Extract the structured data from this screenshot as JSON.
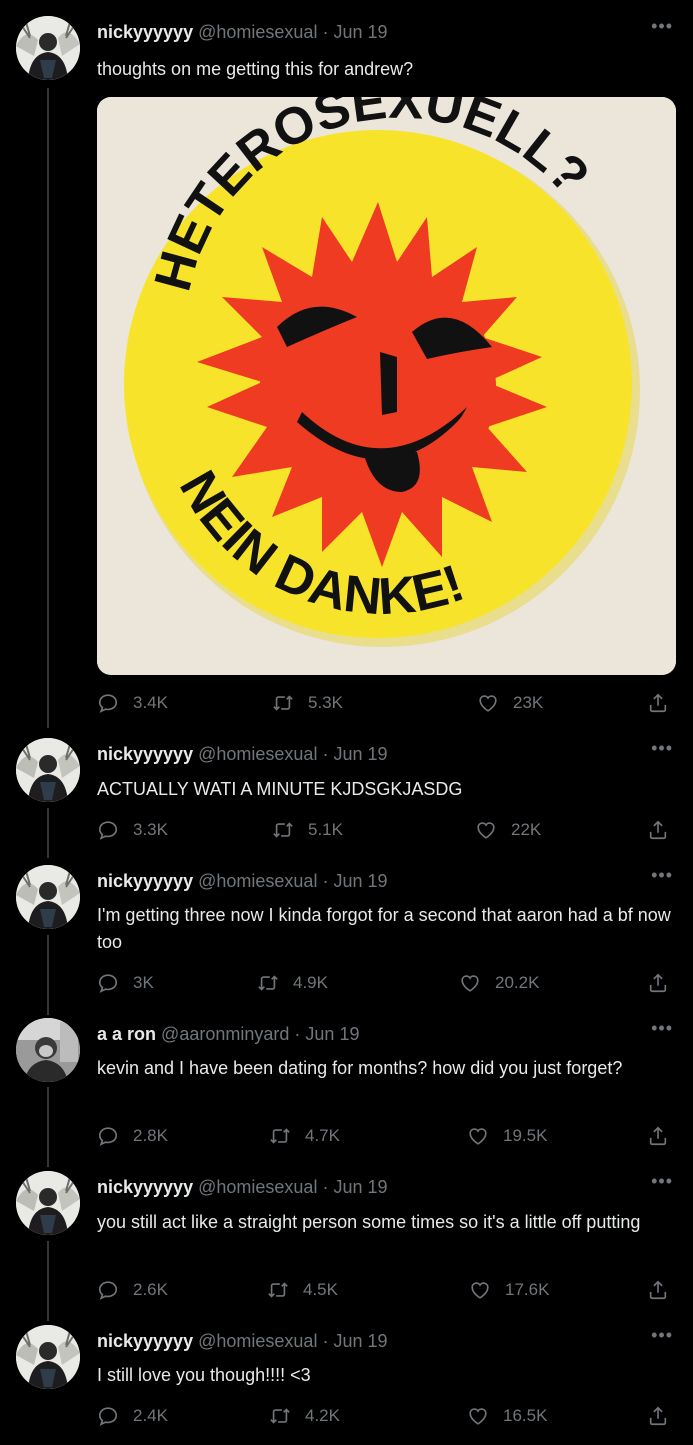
{
  "tweets": [
    {
      "name": "nickyyyyyy",
      "handle": "@homiesexual",
      "sep": "·",
      "date": "Jun 19",
      "text": "thoughts on me getting this for andrew?",
      "media": {
        "top_text": "HETEROSEXUELL?",
        "bottom_text": "NEIN DANKE!"
      },
      "replies": "3.4K",
      "retweets": "5.3K",
      "likes": "23K"
    },
    {
      "name": "nickyyyyyy",
      "handle": "@homiesexual",
      "sep": "·",
      "date": "Jun 19",
      "text": "ACTUALLY WATI A MINUTE KJDSGKJASDG",
      "replies": "3.3K",
      "retweets": "5.1K",
      "likes": "22K"
    },
    {
      "name": "nickyyyyyy",
      "handle": "@homiesexual",
      "sep": "·",
      "date": "Jun 19",
      "text": "I'm getting three now I kinda forgot for a second that aaron had a bf now too",
      "replies": "3K",
      "retweets": "4.9K",
      "likes": "20.2K"
    },
    {
      "name": "a a ron",
      "handle": "@aaronminyard",
      "sep": "·",
      "date": "Jun 19",
      "text": "kevin and I have been dating for months? how did you just forget?",
      "replies": "2.8K",
      "retweets": "4.7K",
      "likes": "19.5K"
    },
    {
      "name": "nickyyyyyy",
      "handle": "@homiesexual",
      "sep": "·",
      "date": "Jun 19",
      "text": "you still act like a straight person some times so it's a little off putting",
      "replies": "2.6K",
      "retweets": "4.5K",
      "likes": "17.6K"
    },
    {
      "name": "nickyyyyyy",
      "handle": "@homiesexual",
      "sep": "·",
      "date": "Jun 19",
      "text": "I still love you though!!!! <3",
      "replies": "2.4K",
      "retweets": "4.2K",
      "likes": "16.5K"
    }
  ],
  "icons": {
    "more": "more-icon",
    "reply": "reply-icon",
    "retweet": "retweet-icon",
    "like": "heart-icon",
    "share": "share-icon"
  },
  "colors": {
    "background": "#000000",
    "text": "#e7e9ea",
    "secondary": "#71767b",
    "badge_yellow": "#f7e42a",
    "badge_red": "#ef3b22"
  }
}
